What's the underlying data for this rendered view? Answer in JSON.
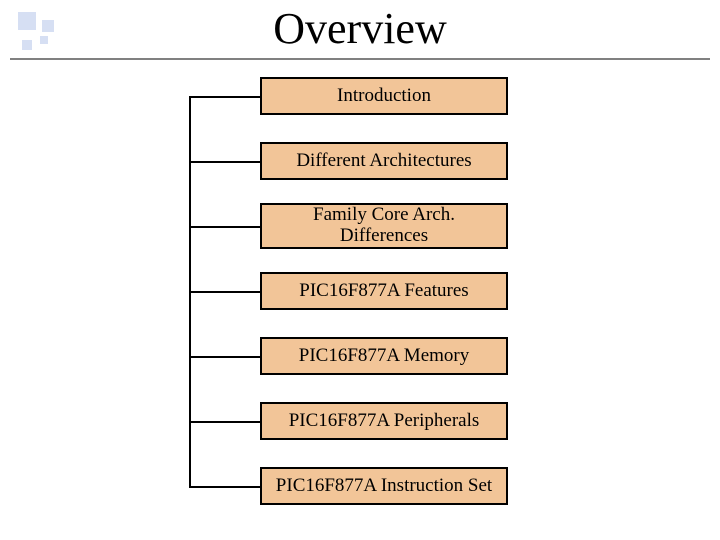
{
  "title": "Overview",
  "nodes": [
    {
      "label": "Introduction"
    },
    {
      "label": "Different Architectures"
    },
    {
      "label": "Family Core Arch. Differences"
    },
    {
      "label": "PIC16F877A Features"
    },
    {
      "label": "PIC16F877A Memory"
    },
    {
      "label": "PIC16F877A Peripherals"
    },
    {
      "label": "PIC16F877A Instruction Set"
    }
  ],
  "colors": {
    "node_fill": "#f2c598",
    "bullet_fill": "#d6dff3",
    "rule": "#808080"
  }
}
